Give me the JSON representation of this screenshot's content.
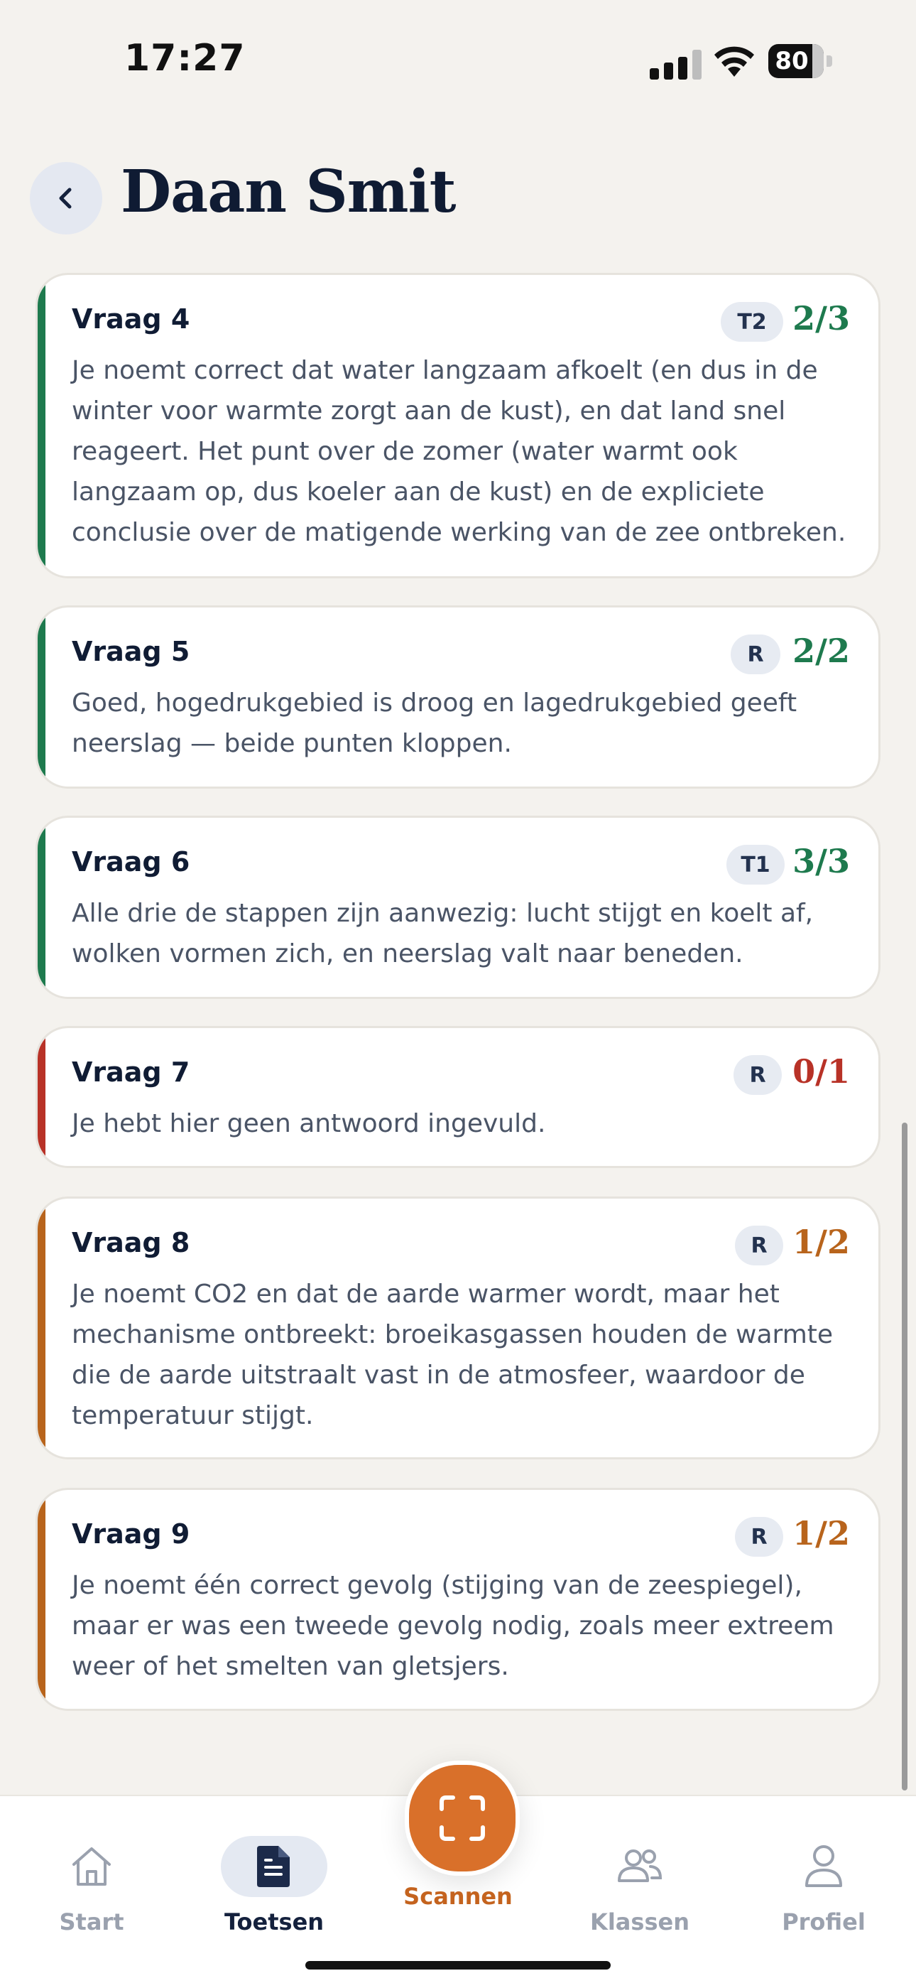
{
  "status_bar": {
    "time": "17:27",
    "battery": "80"
  },
  "header": {
    "title": "Daan Smit"
  },
  "colors": {
    "green": "#1E7A4E",
    "red": "#B83227",
    "orange": "#B8641C"
  },
  "questions": [
    {
      "title": "Vraag 4",
      "tag": "T2",
      "score": "2/3",
      "status": "green",
      "feedback": "Je noemt correct dat water langzaam afkoelt (en dus in de winter voor warmte zorgt aan de kust), en dat land snel reageert. Het punt over de zomer (water warmt ook langzaam op, dus koeler aan de kust) en de expliciete conclusie over de matigende werking van de zee ontbreken."
    },
    {
      "title": "Vraag 5",
      "tag": "R",
      "score": "2/2",
      "status": "green",
      "feedback": "Goed, hogedrukgebied is droog en lagedrukgebied geeft neerslag — beide punten kloppen."
    },
    {
      "title": "Vraag 6",
      "tag": "T1",
      "score": "3/3",
      "status": "green",
      "feedback": "Alle drie de stappen zijn aanwezig: lucht stijgt en koelt af, wolken vormen zich, en neerslag valt naar beneden."
    },
    {
      "title": "Vraag 7",
      "tag": "R",
      "score": "0/1",
      "status": "red",
      "feedback": "Je hebt hier geen antwoord ingevuld."
    },
    {
      "title": "Vraag 8",
      "tag": "R",
      "score": "1/2",
      "status": "orange",
      "feedback": "Je noemt CO2 en dat de aarde warmer wordt, maar het mechanisme ontbreekt: broeikasgassen houden de warmte die de aarde uitstraalt vast in de atmosfeer, waardoor de temperatuur stijgt."
    },
    {
      "title": "Vraag 9",
      "tag": "R",
      "score": "1/2",
      "status": "orange",
      "feedback": "Je noemt één correct gevolg (stijging van de zeespiegel), maar er was een tweede gevolg nodig, zoals meer extreem weer of het smelten van gletsjers."
    }
  ],
  "tabs": {
    "start": "Start",
    "toetsen": "Toetsen",
    "scannen": "Scannen",
    "klassen": "Klassen",
    "profiel": "Profiel"
  }
}
